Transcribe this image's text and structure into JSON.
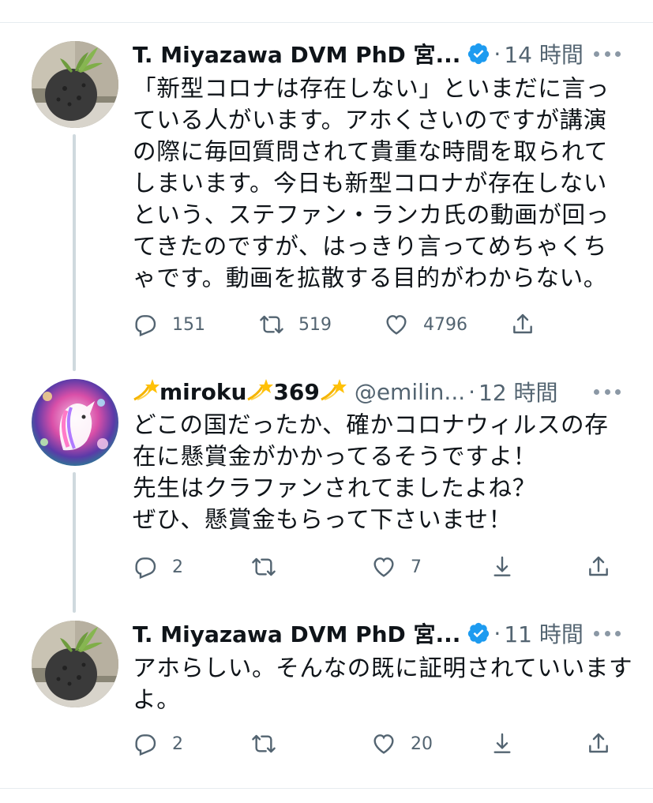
{
  "tweets": [
    {
      "name": "T. Miyazawa DVM PhD 宮...",
      "verified": true,
      "handle": "",
      "time": "14 時間",
      "lines": [
        "「新型コロナは存在しない」といまだに言っ",
        "ている人がいます。アホくさいのですが講演",
        "の際に毎回質問されて貴重な時間を取られて",
        "しまいます。今日も新型コロナが存在しない",
        "という、ステファン・ランカ氏の動画が回っ",
        "てきたのですが、はっきり言ってめちゃくち",
        "ゃです。動画を拡散する目的がわからない。"
      ],
      "reply_count": "151",
      "retweet_count": "519",
      "like_count": "4796",
      "avatar_icon": "sphere-plant-photo"
    },
    {
      "name_part1": "miroku",
      "name_part2": "369",
      "name_emoji": "dizzy-icon",
      "handle": "@emilin...",
      "time": "12 時間",
      "lines": [
        "どこの国だったか、確かコロナウィルスの存",
        "在に懸賞金がかかってるそうですよ！",
        "先生はクラファンされてましたよね？",
        "ぜひ、懸賞金もらって下さいませ！"
      ],
      "reply_count": "2",
      "retweet_count": "",
      "like_count": "7",
      "avatar_icon": "unicorn-galaxy-art"
    },
    {
      "name": "T. Miyazawa DVM PhD 宮...",
      "verified": true,
      "handle": "",
      "time": "11 時間",
      "lines": [
        "アホらしい。そんなの既に証明されていいます",
        "よ。"
      ],
      "reply_count": "2",
      "retweet_count": "",
      "like_count": "20",
      "avatar_icon": "sphere-plant-photo"
    }
  ],
  "colors": {
    "text": "#0f1419",
    "secondary": "#536471",
    "verified_blue": "#1d9bf0",
    "thread_line": "#cfd9de"
  }
}
